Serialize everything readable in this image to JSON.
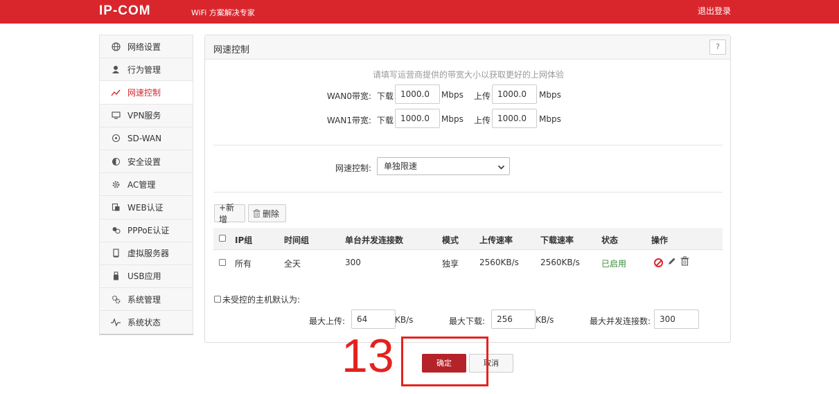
{
  "header": {
    "logo": "IP-COM",
    "tagline": "WiFi 方案解决专家",
    "logout": "退出登录",
    "bg_color": "#d9262c"
  },
  "sidebar": {
    "items": [
      {
        "label": "网络设置",
        "icon": "globe-icon",
        "active": false
      },
      {
        "label": "行为管理",
        "icon": "user-icon",
        "active": false
      },
      {
        "label": "网速控制",
        "icon": "speed-chart-icon",
        "active": true
      },
      {
        "label": "VPN服务",
        "icon": "monitor-icon",
        "active": false
      },
      {
        "label": "SD-WAN",
        "icon": "sdwan-icon",
        "active": false
      },
      {
        "label": "安全设置",
        "icon": "shield-icon",
        "active": false
      },
      {
        "label": "AC管理",
        "icon": "ac-gear-icon",
        "active": false
      },
      {
        "label": "WEB认证",
        "icon": "web-auth-icon",
        "active": false
      },
      {
        "label": "PPPoE认证",
        "icon": "pppoe-icon",
        "active": false
      },
      {
        "label": "虚拟服务器",
        "icon": "server-icon",
        "active": false
      },
      {
        "label": "USB应用",
        "icon": "usb-icon",
        "active": false
      },
      {
        "label": "系统管理",
        "icon": "gears-icon",
        "active": false
      },
      {
        "label": "系统状态",
        "icon": "pulse-icon",
        "active": false
      }
    ]
  },
  "panel": {
    "title": "网速控制",
    "help": "?",
    "hint": "请填写运营商提供的带宽大小以获取更好的上网体验",
    "wan": [
      {
        "label": "WAN0带宽:",
        "down_label": "下载",
        "down_value": "1000.0",
        "down_unit": "Mbps",
        "up_label": "上传",
        "up_value": "1000.0",
        "up_unit": "Mbps"
      },
      {
        "label": "WAN1带宽:",
        "down_label": "下载",
        "down_value": "1000.0",
        "down_unit": "Mbps",
        "up_label": "上传",
        "up_value": "1000.0",
        "up_unit": "Mbps"
      }
    ],
    "speed_control_label": "网速控制:",
    "speed_control_value": "单独限速",
    "add_button": "+新增",
    "delete_button": "删除",
    "table": {
      "headers": [
        "IP组",
        "时间组",
        "单台并发连接数",
        "模式",
        "上传速率",
        "下载速率",
        "状态",
        "操作"
      ],
      "rows": [
        {
          "ip": "所有",
          "time": "全天",
          "conn": "300",
          "mode": "独享",
          "up": "2560KB/s",
          "down": "2560KB/s",
          "status": "已启用"
        }
      ]
    },
    "uncontrolled_label": "未受控的主机默认为:",
    "max_up_label": "最大上传:",
    "max_up_value": "64",
    "max_up_unit": "KB/s",
    "max_down_label": "最大下载:",
    "max_down_value": "256",
    "max_down_unit": "KB/s",
    "max_conn_label": "最大并发连接数:",
    "max_conn_value": "300"
  },
  "actions": {
    "ok": "确定",
    "cancel": "取消"
  },
  "annotation": {
    "step_number": "13",
    "color": "#e3221e"
  }
}
